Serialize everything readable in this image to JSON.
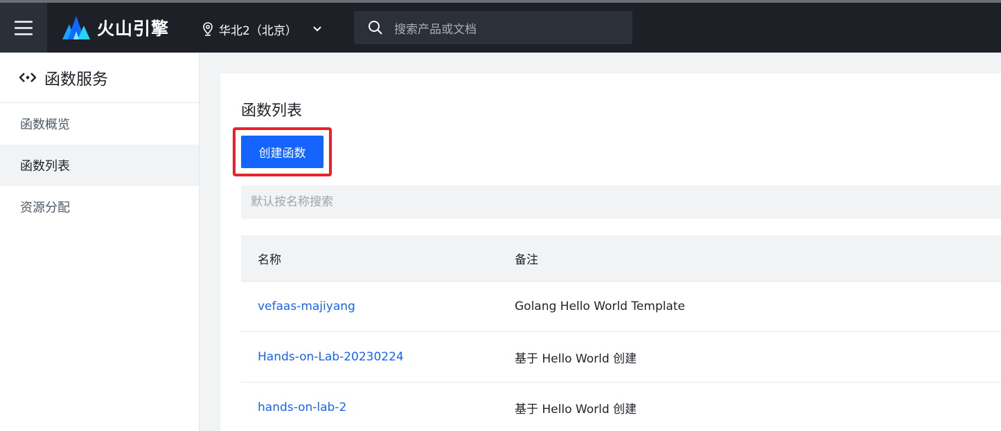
{
  "topbar": {
    "brand": "火山引擎",
    "region": "华北2（北京）",
    "search_placeholder": "搜索产品或文档"
  },
  "sidebar": {
    "title": "函数服务",
    "items": [
      {
        "label": "函数概览",
        "active": false
      },
      {
        "label": "函数列表",
        "active": true
      },
      {
        "label": "资源分配",
        "active": false
      }
    ]
  },
  "main": {
    "title": "函数列表",
    "create_button": "创建函数",
    "search_placeholder": "默认按名称搜索",
    "table": {
      "columns": [
        "名称",
        "备注"
      ],
      "rows": [
        {
          "name": "vefaas-majiyang",
          "note": "Golang Hello World Template"
        },
        {
          "name": "Hands-on-Lab-20230224",
          "note": "基于 Hello World 创建"
        },
        {
          "name": "hands-on-lab-2",
          "note": "基于 Hello World 创建"
        }
      ]
    }
  },
  "colors": {
    "topbar_bg": "#1d2127",
    "primary": "#1664ff",
    "highlight": "#e8212b"
  }
}
